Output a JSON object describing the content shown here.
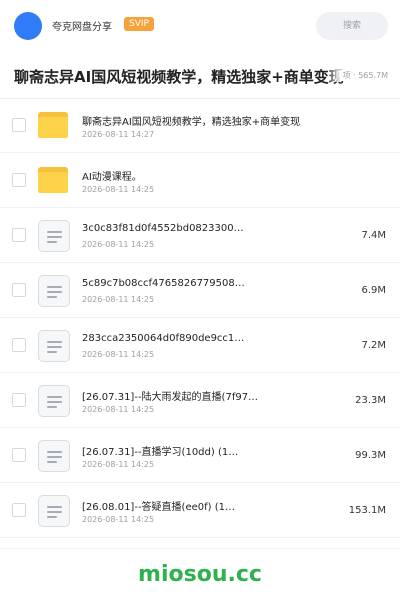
{
  "header": {
    "site_name": "夸克网盘分享",
    "badge": "SVIP",
    "search_label": "搜索"
  },
  "title": {
    "text": "聊斋志异AI国风短视频教学，精选独家+商单变现",
    "meta": "项 · 565.7M"
  },
  "files": [
    {
      "type": "folder",
      "icon": "folder-icon",
      "name": "聊斋志异AI国风短视频教学，精选独家+商单变现",
      "date": "2026-08-11 14:27",
      "size": ""
    },
    {
      "type": "folder",
      "icon": "folder-icon",
      "name": "AI动漫课程。",
      "date": "2026-08-11 14:25",
      "size": ""
    },
    {
      "type": "file",
      "icon": "document-icon",
      "name": "3c0c83f81d0f4552bd0823300…",
      "date": "2026-08-11 14:25",
      "size": "7.4M"
    },
    {
      "type": "file",
      "icon": "document-icon",
      "name": "5c89c7b08ccf4765826779508…",
      "date": "2026-08-11 14:25",
      "size": "6.9M"
    },
    {
      "type": "file",
      "icon": "document-icon",
      "name": "283cca2350064d0f890de9cc1…",
      "date": "2026-08-11 14:25",
      "size": "7.2M"
    },
    {
      "type": "file",
      "icon": "document-icon",
      "name": "[26.07.31]--陆大雨发起的直播(7f97…",
      "date": "2026-08-11 14:25",
      "size": "23.3M"
    },
    {
      "type": "file",
      "icon": "document-icon",
      "name": "[26.07.31]--直播学习(10dd) (1…",
      "date": "2026-08-11 14:25",
      "size": "99.3M"
    },
    {
      "type": "file",
      "icon": "document-icon",
      "name": "[26.08.01]--答疑直播(ee0f) (1…",
      "date": "2026-08-11 14:25",
      "size": "153.1M"
    }
  ],
  "watermark": "miosou.cc",
  "colors": {
    "avatar": "#2f7cf6",
    "badge": "#f7a23b",
    "folder": "#fdd449",
    "watermark": "#2fb14d"
  }
}
